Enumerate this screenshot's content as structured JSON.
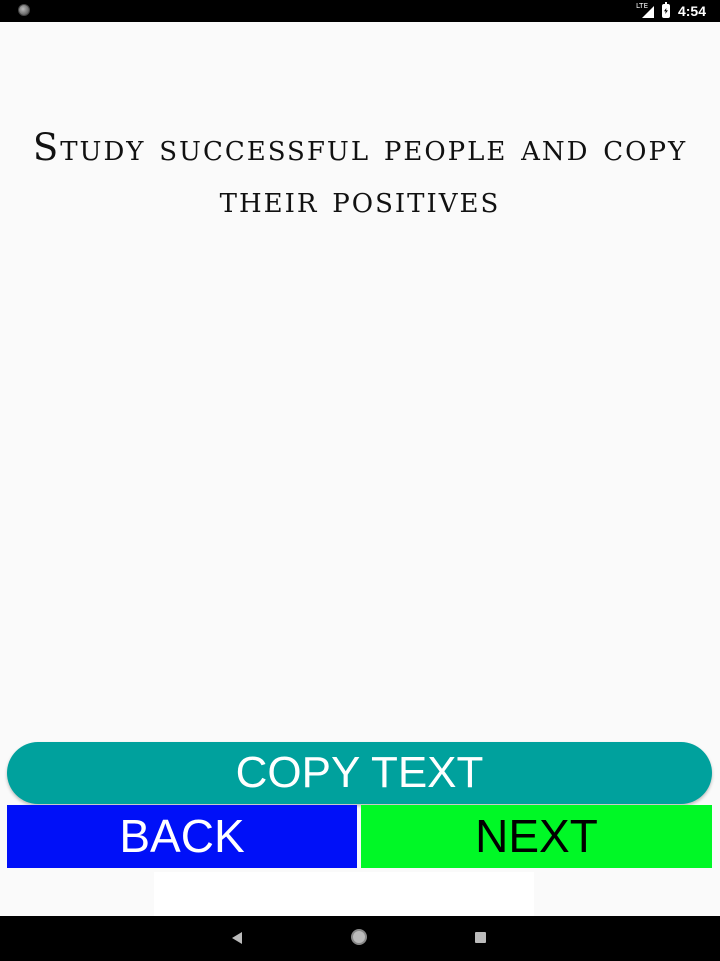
{
  "status_bar": {
    "network_label": "LTE",
    "time": "4:54",
    "icons": [
      "notification-dot-icon",
      "signal-icon",
      "battery-charging-icon"
    ]
  },
  "quote": {
    "text": "Study successful people and copy their positives"
  },
  "buttons": {
    "copy_label": "COPY TEXT",
    "back_label": "BACK",
    "next_label": "NEXT"
  },
  "colors": {
    "copy_button": "#00a19d",
    "back_button": "#0010f8",
    "next_button": "#00f826",
    "background": "#fafafa"
  },
  "nav_bar": {
    "icons": [
      "nav-back-icon",
      "nav-home-icon",
      "nav-recents-icon"
    ]
  }
}
